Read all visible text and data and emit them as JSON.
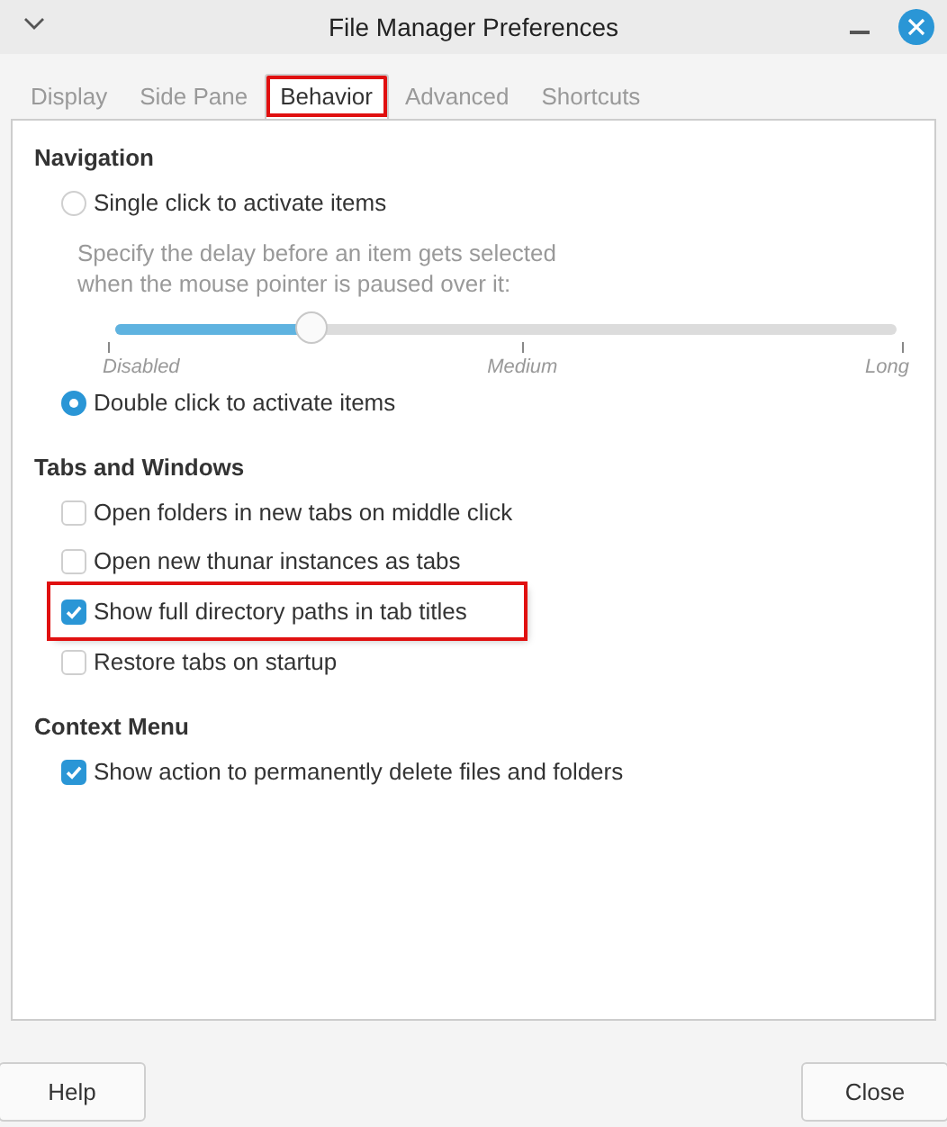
{
  "window": {
    "title": "File Manager Preferences"
  },
  "tabs": [
    {
      "label": "Display",
      "selected": false,
      "highlighted": false
    },
    {
      "label": "Side Pane",
      "selected": false,
      "highlighted": false
    },
    {
      "label": "Behavior",
      "selected": true,
      "highlighted": true
    },
    {
      "label": "Advanced",
      "selected": false,
      "highlighted": false
    },
    {
      "label": "Shortcuts",
      "selected": false,
      "highlighted": false
    }
  ],
  "sections": [
    {
      "heading": "Navigation",
      "items": [
        {
          "kind": "radio",
          "label": "Single click to activate items",
          "selected": false,
          "highlighted": false
        },
        {
          "kind": "hint",
          "text": "Specify the delay before an item gets selected\nwhen the mouse pointer is paused over it:"
        },
        {
          "kind": "slider",
          "level": 0.25,
          "marks": [
            "Disabled",
            "Medium",
            "Long"
          ]
        },
        {
          "kind": "radio",
          "label": "Double click to activate items",
          "selected": true,
          "highlighted": false
        }
      ]
    },
    {
      "heading": "Tabs and Windows",
      "items": [
        {
          "kind": "checkbox",
          "label": "Open folders in new tabs on middle click",
          "checked": false,
          "highlighted": false
        },
        {
          "kind": "checkbox",
          "label": "Open new thunar instances as tabs",
          "checked": false,
          "highlighted": false
        },
        {
          "kind": "checkbox",
          "label": "Show full directory paths in tab titles",
          "checked": true,
          "highlighted": true
        },
        {
          "kind": "checkbox",
          "label": "Restore tabs on startup",
          "checked": false,
          "highlighted": false
        }
      ]
    },
    {
      "heading": "Context Menu",
      "items": [
        {
          "kind": "checkbox",
          "label": "Show action to permanently delete files and folders",
          "checked": true,
          "highlighted": false
        }
      ]
    }
  ],
  "buttons": [
    "Help",
    "Close"
  ]
}
